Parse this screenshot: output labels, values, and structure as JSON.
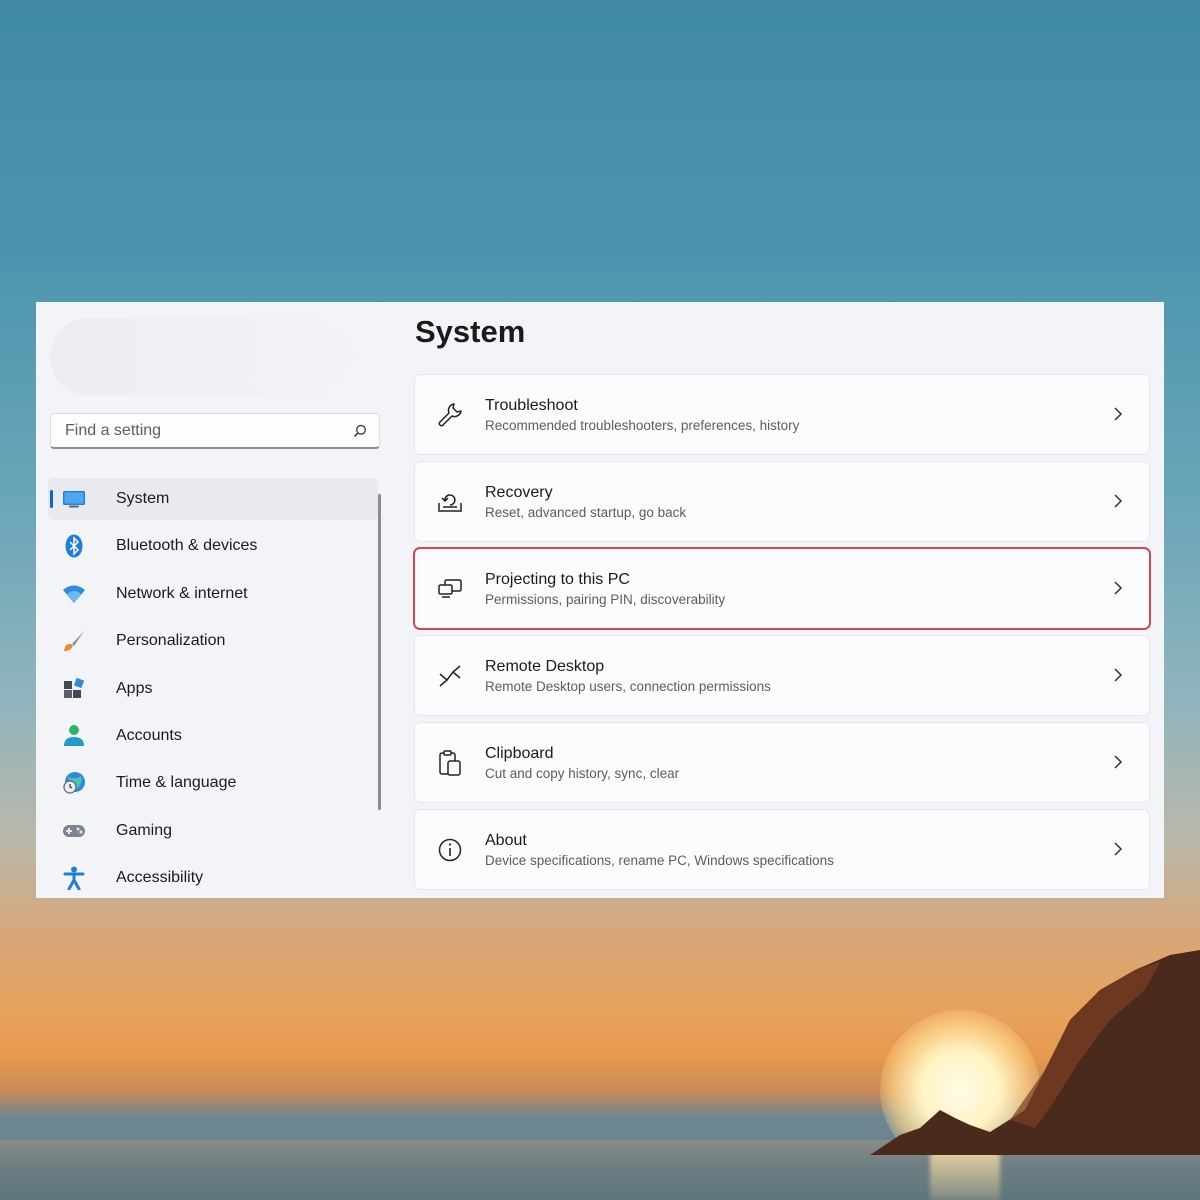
{
  "search": {
    "placeholder": "Find a setting",
    "icon": "search-icon"
  },
  "sidebar": {
    "items": [
      {
        "label": "System",
        "icon": "monitor-icon",
        "active": true
      },
      {
        "label": "Bluetooth & devices",
        "icon": "bluetooth-icon"
      },
      {
        "label": "Network & internet",
        "icon": "wifi-icon"
      },
      {
        "label": "Personalization",
        "icon": "brush-icon"
      },
      {
        "label": "Apps",
        "icon": "apps-icon"
      },
      {
        "label": "Accounts",
        "icon": "person-icon"
      },
      {
        "label": "Time & language",
        "icon": "globe-clock-icon"
      },
      {
        "label": "Gaming",
        "icon": "gamepad-icon"
      },
      {
        "label": "Accessibility",
        "icon": "accessibility-icon"
      }
    ]
  },
  "main": {
    "title": "System",
    "cards": [
      {
        "title": "Troubleshoot",
        "subtitle": "Recommended troubleshooters, preferences, history",
        "icon": "wrench-icon"
      },
      {
        "title": "Recovery",
        "subtitle": "Reset, advanced startup, go back",
        "icon": "recovery-icon"
      },
      {
        "title": "Projecting to this PC",
        "subtitle": "Permissions, pairing PIN, discoverability",
        "icon": "projecting-icon",
        "highlighted": true,
        "highlight_color": "#d24a4e"
      },
      {
        "title": "Remote Desktop",
        "subtitle": "Remote Desktop users, connection permissions",
        "icon": "remote-desktop-icon"
      },
      {
        "title": "Clipboard",
        "subtitle": "Cut and copy history, sync, clear",
        "icon": "clipboard-icon"
      },
      {
        "title": "About",
        "subtitle": "Device specifications, rename PC, Windows specifications",
        "icon": "info-icon"
      }
    ]
  },
  "colors": {
    "accent": "#1565c0",
    "window_bg": "#f3f4f8",
    "card_bg": "#fbfbfd"
  }
}
